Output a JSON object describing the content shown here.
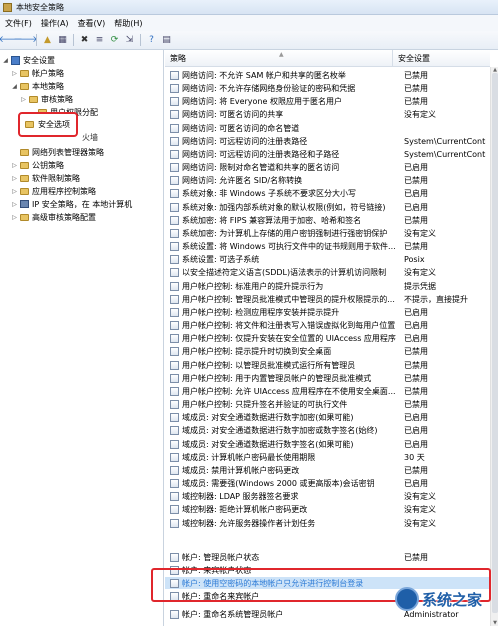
{
  "window": {
    "title": "本地安全策略"
  },
  "menu": [
    "文件(F)",
    "操作(A)",
    "查看(V)",
    "帮助(H)"
  ],
  "toolbar": {
    "back": "🡐",
    "forward": "🡒",
    "up": "▲",
    "show_hide": "▦",
    "delete": "✖",
    "properties": "≡",
    "refresh": "⟳",
    "export": "⇲",
    "help": "?",
    "view": "▤"
  },
  "tree": [
    {
      "label": "安全设置",
      "toggle": "◢",
      "icon": "monitor-icon"
    },
    {
      "label": "帐户策略",
      "toggle": "▷",
      "icon": "folder-icon"
    },
    {
      "label": "本地策略",
      "toggle": "◢",
      "icon": "folder-icon"
    },
    {
      "label": "审核策略",
      "toggle": "▷",
      "icon": "folder-icon"
    },
    {
      "label": "用户权限分配",
      "toggle": "",
      "icon": "folder-icon"
    },
    {
      "label": "安全选项",
      "toggle": "",
      "icon": "folder-icon"
    },
    {
      "label": "高级安全 Windows 防火墙",
      "toggle": "",
      "icon": "folder-icon"
    },
    {
      "label": "网络列表管理器策略",
      "toggle": "",
      "icon": "folder-icon"
    },
    {
      "label": "公钥策略",
      "toggle": "▷",
      "icon": "folder-icon"
    },
    {
      "label": "软件限制策略",
      "toggle": "▷",
      "icon": "folder-icon"
    },
    {
      "label": "应用程序控制策略",
      "toggle": "▷",
      "icon": "folder-icon"
    },
    {
      "label": "IP 安全策略，在 本地计算机",
      "toggle": "▷",
      "icon": "computer-icon"
    },
    {
      "label": "高级审核策略配置",
      "toggle": "▷",
      "icon": "folder-icon"
    }
  ],
  "overlap_text": "火墙",
  "columns": {
    "policy": "策略",
    "setting": "安全设置"
  },
  "policies": [
    {
      "name": "网络访问: 不允许 SAM 帐户和共享的匿名枚举",
      "setting": "已禁用"
    },
    {
      "name": "网络访问: 不允许存储网络身份验证的密码和凭据",
      "setting": "已禁用"
    },
    {
      "name": "网络访问: 将 Everyone 权限应用于匿名用户",
      "setting": "已禁用"
    },
    {
      "name": "网络访问: 可匿名访问的共享",
      "setting": "没有定义"
    },
    {
      "name": "网络访问: 可匿名访问的命名管道",
      "setting": ""
    },
    {
      "name": "网络访问: 可远程访问的注册表路径",
      "setting": "System\\CurrentContro..."
    },
    {
      "name": "网络访问: 可远程访问的注册表路径和子路径",
      "setting": "System\\CurrentContro..."
    },
    {
      "name": "网络访问: 限制对命名管道和共享的匿名访问",
      "setting": "已启用"
    },
    {
      "name": "网络访问: 允许匿名 SID/名称转换",
      "setting": "已禁用"
    },
    {
      "name": "系统对象: 非 Windows 子系统不要求区分大小写",
      "setting": "已启用"
    },
    {
      "name": "系统对象: 加强内部系统对象的默认权限(例如，符号链接)",
      "setting": "已启用"
    },
    {
      "name": "系统加密: 将 FIPS 兼容算法用于加密、哈希和签名",
      "setting": "已禁用"
    },
    {
      "name": "系统加密: 为计算机上存储的用户密钥强制进行强密钥保护",
      "setting": "没有定义"
    },
    {
      "name": "系统设置: 将 Windows 可执行文件中的证书规则用于软件...",
      "setting": "已禁用"
    },
    {
      "name": "系统设置: 可选子系统",
      "setting": "Posix"
    },
    {
      "name": "以安全描述符定义语言(SDDL)语法表示的计算机访问限制",
      "setting": "没有定义"
    },
    {
      "name": "用户帐户控制: 标准用户的提升提示行为",
      "setting": "提示凭据"
    },
    {
      "name": "用户帐户控制: 管理员批准模式中管理员的提升权限提示的...",
      "setting": "不提示，直接提升"
    },
    {
      "name": "用户帐户控制: 检测应用程序安装并提示提升",
      "setting": "已启用"
    },
    {
      "name": "用户帐户控制: 将文件和注册表写入错误虚拟化到每用户位置",
      "setting": "已启用"
    },
    {
      "name": "用户帐户控制: 仅提升安装在安全位置的 UIAccess 应用程序",
      "setting": "已启用"
    },
    {
      "name": "用户帐户控制: 提示提升时切换到安全桌面",
      "setting": "已禁用"
    },
    {
      "name": "用户帐户控制: 以管理员批准模式运行所有管理员",
      "setting": "已禁用"
    },
    {
      "name": "用户帐户控制: 用于内置管理员帐户的管理员批准模式",
      "setting": "已禁用"
    },
    {
      "name": "用户帐户控制: 允许 UIAccess 应用程序在不使用安全桌面...",
      "setting": "已禁用"
    },
    {
      "name": "用户帐户控制: 只提升签名并验证的可执行文件",
      "setting": "已禁用"
    },
    {
      "name": "域成员: 对安全通道数据进行数字加密(如果可能)",
      "setting": "已启用"
    },
    {
      "name": "域成员: 对安全通道数据进行数字加密或数字签名(始终)",
      "setting": "已启用"
    },
    {
      "name": "域成员: 对安全通道数据进行数字签名(如果可能)",
      "setting": "已启用"
    },
    {
      "name": "域成员: 计算机帐户密码最长使用期限",
      "setting": "30 天"
    },
    {
      "name": "域成员: 禁用计算机帐户密码更改",
      "setting": "已禁用"
    },
    {
      "name": "域成员: 需要强(Windows 2000 或更高版本)会话密钥",
      "setting": "已启用"
    },
    {
      "name": "域控制器: LDAP 服务器签名要求",
      "setting": "没有定义"
    },
    {
      "name": "域控制器: 拒绝计算机帐户密码更改",
      "setting": "没有定义"
    },
    {
      "name": "域控制器: 允许服务器操作者计划任务",
      "setting": "没有定义"
    },
    {
      "name": "帐户: 管理员帐户状态",
      "setting": "已禁用"
    },
    {
      "name": "帐户: 来宾帐户状态",
      "setting": ""
    },
    {
      "name": "帐户: 使用空密码的本地帐户只允许进行控制台登录",
      "setting": ""
    },
    {
      "name": "帐户: 重命名来宾帐户",
      "setting": ""
    },
    {
      "name": "帐户: 重命名系统管理员帐户",
      "setting": "Administrator"
    }
  ],
  "watermark": {
    "text": "系统之家"
  }
}
